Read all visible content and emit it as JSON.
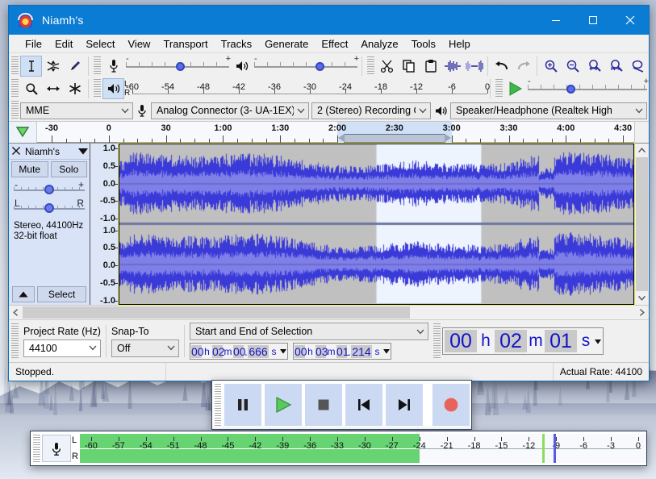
{
  "window": {
    "title": "Niamh's",
    "app_icon": "audacity-icon",
    "minimize": "minimize-icon",
    "maximize": "maximize-icon",
    "close": "close-icon"
  },
  "menubar": {
    "items": [
      "File",
      "Edit",
      "Select",
      "View",
      "Transport",
      "Tracks",
      "Generate",
      "Effect",
      "Analyze",
      "Tools",
      "Help"
    ]
  },
  "tools_toolbar": {
    "buttons": [
      {
        "name": "selection-tool",
        "icon": "i-beam-icon",
        "selected": true
      },
      {
        "name": "envelope-tool",
        "icon": "envelope-icon",
        "selected": false
      },
      {
        "name": "draw-tool",
        "icon": "pencil-icon",
        "selected": false
      },
      {
        "name": "zoom-tool",
        "icon": "magnifier-icon",
        "selected": false
      },
      {
        "name": "timeshift-tool",
        "icon": "time-shift-icon",
        "selected": false
      },
      {
        "name": "multi-tool",
        "icon": "multi-tool-icon",
        "selected": false
      }
    ]
  },
  "recording_volume": {
    "icon": "microphone-icon",
    "minus": "-",
    "plus": "+",
    "value_pct": 52
  },
  "playback_volume": {
    "icon": "speaker-icon",
    "minus": "-",
    "plus": "+",
    "value_pct": 62
  },
  "recording_meter_toolbar": {
    "icon": "speaker-icon",
    "channels": [
      "L",
      "R"
    ],
    "scale": [
      "-60",
      "-54",
      "-48",
      "-42",
      "-36",
      "-30",
      "-24",
      "-18",
      "-12",
      "-6",
      "0"
    ]
  },
  "edit_toolbar": {
    "buttons": [
      {
        "name": "cut-button",
        "icon": "scissors-icon"
      },
      {
        "name": "copy-button",
        "icon": "copy-icon"
      },
      {
        "name": "paste-button",
        "icon": "clipboard-icon"
      },
      {
        "name": "trim-audio-button",
        "icon": "trim-outside-icon"
      },
      {
        "name": "silence-audio-button",
        "icon": "silence-selection-icon"
      },
      {
        "name": "undo-button",
        "icon": "undo-arrow-icon"
      },
      {
        "name": "redo-button",
        "icon": "redo-arrow-icon"
      },
      {
        "name": "zoom-in-button",
        "icon": "zoom-in-icon"
      },
      {
        "name": "zoom-out-button",
        "icon": "zoom-out-icon"
      },
      {
        "name": "fit-selection-button",
        "icon": "fit-selection-icon"
      },
      {
        "name": "fit-project-button",
        "icon": "fit-project-icon"
      },
      {
        "name": "zoom-toggle-button",
        "icon": "zoom-toggle-icon"
      }
    ]
  },
  "play_at_speed": {
    "icon": "play-green-icon",
    "minus": "-",
    "plus": "+",
    "value_pct": 33
  },
  "device_toolbar": {
    "host": {
      "value": "MME",
      "caret": "chevron-down-icon"
    },
    "input_icon": "microphone-icon",
    "input_device": {
      "value": "Analog Connector (3- UA-1EX)",
      "caret": "chevron-down-icon"
    },
    "input_channels": {
      "value": "2 (Stereo) Recording C",
      "caret": "chevron-down-icon"
    },
    "output_icon": "speaker-icon",
    "output_device": {
      "value": "Speaker/Headphone (Realtek High",
      "caret": "chevron-down-icon"
    }
  },
  "timeline": {
    "pin_icon": "pinned-play-head-icon",
    "labels": [
      "-30",
      "0",
      "30",
      "1:00",
      "1:30",
      "2:00",
      "2:30",
      "3:00",
      "3:30",
      "4:00",
      "4:30"
    ],
    "selection_start_label": "2:00",
    "selection_end_label": "3:00"
  },
  "track": {
    "close_icon": "close-track-icon",
    "name": "Niamh's",
    "menu_icon": "track-menu-caret-icon",
    "mute_label": "Mute",
    "solo_label": "Solo",
    "gain_slider": {
      "min": "-",
      "max": "+",
      "name": "gain-slider"
    },
    "pan_slider": {
      "min": "L",
      "max": "R",
      "name": "pan-slider"
    },
    "info_line1": "Stereo, 44100Hz",
    "info_line2": "32-bit float",
    "collapse_icon": "collapse-track-icon",
    "select_label": "Select",
    "vertical_ruler": [
      "1.0",
      "0.5",
      "0.0",
      "-0.5",
      "-1.0"
    ]
  },
  "selection_toolbar": {
    "project_rate_label": "Project Rate (Hz)",
    "project_rate_value": "44100",
    "snap_to_label": "Snap-To",
    "snap_to_value": "Off",
    "selection_mode": "Start and End of Selection",
    "start_time": {
      "h": "00",
      "m": "02",
      "s": "00",
      "frac": "666"
    },
    "end_time": {
      "h": "00",
      "m": "03",
      "s": "01",
      "frac": "214"
    },
    "units": {
      "h": "h",
      "m": "m",
      "s": "s"
    },
    "audio_position": {
      "h": "00",
      "m": "02",
      "s": "01"
    }
  },
  "statusbar": {
    "state": "Stopped.",
    "middle": "",
    "actual_rate": "Actual Rate: 44100"
  },
  "transport": {
    "buttons": [
      {
        "name": "pause-button",
        "icon": "pause-icon",
        "color": "#222222"
      },
      {
        "name": "play-button",
        "icon": "play-icon",
        "color": "#41b649"
      },
      {
        "name": "stop-button",
        "icon": "stop-icon",
        "color": "#555555"
      },
      {
        "name": "skip-to-start-button",
        "icon": "skip-start-icon",
        "color": "#111111"
      },
      {
        "name": "skip-to-end-button",
        "icon": "skip-end-icon",
        "color": "#111111"
      },
      {
        "name": "record-button",
        "icon": "record-icon",
        "color": "#e35c53"
      }
    ]
  },
  "meter_float": {
    "mic_icon": "microphone-icon",
    "channel_l": "L",
    "channel_r": "R",
    "scale": [
      "-60",
      "-57",
      "-54",
      "-51",
      "-48",
      "-45",
      "-42",
      "-39",
      "-36",
      "-33",
      "-30",
      "-27",
      "-24",
      "-21",
      "-18",
      "-15",
      "-12",
      "-9",
      "-6",
      "-3",
      "0"
    ],
    "bar_level_db": -24,
    "peak_hold_db": -10.5,
    "peak_marker_db": -9.3,
    "bar_color": "#67d372",
    "peak_hold_color": "#8ade5c",
    "peak_marker_color": "#5a5ae8"
  },
  "colors": {
    "title_bar": "#0a7cd4",
    "waveform_blue": "#3a3ad8",
    "waveform_rms": "#7f7fe8",
    "track_bg": "#c0c0c0",
    "selected_bg": "#eef4fe",
    "accent": "#cfe0f7"
  }
}
